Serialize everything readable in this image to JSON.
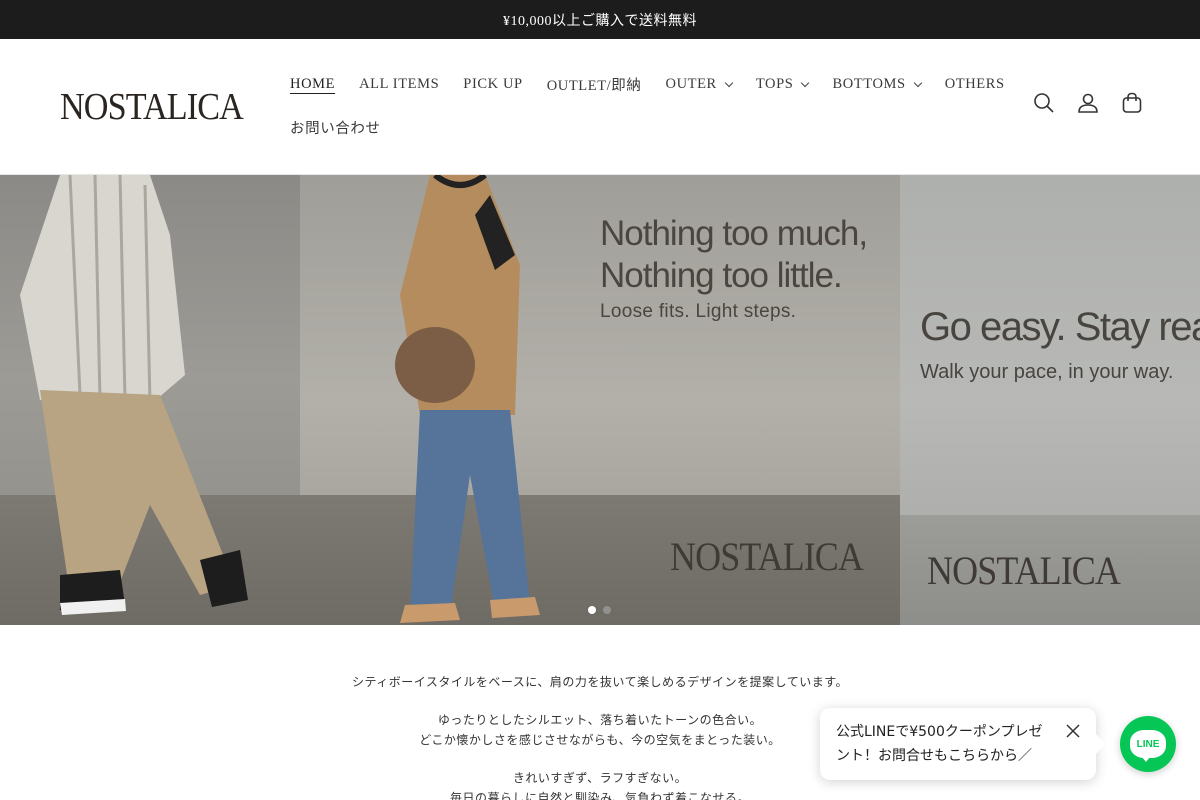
{
  "announcement": {
    "text": "¥10,000以上ご購入で送料無料"
  },
  "header": {
    "logo": "NOSTALICA",
    "nav_row1": [
      {
        "label": "HOME",
        "active": true,
        "dropdown": false
      },
      {
        "label": "ALL ITEMS",
        "active": false,
        "dropdown": false
      },
      {
        "label": "PICK UP",
        "active": false,
        "dropdown": false
      },
      {
        "label": "OUTLET/即納",
        "active": false,
        "dropdown": false
      },
      {
        "label": "OUTER",
        "active": false,
        "dropdown": true
      },
      {
        "label": "TOPS",
        "active": false,
        "dropdown": true
      },
      {
        "label": "BOTTOMS",
        "active": false,
        "dropdown": true
      },
      {
        "label": "OTHERS",
        "active": false,
        "dropdown": false
      }
    ],
    "nav_row2": [
      {
        "label": "お問い合わせ",
        "active": false,
        "dropdown": false
      }
    ],
    "icons": [
      "search-icon",
      "account-icon",
      "cart-icon"
    ]
  },
  "hero": {
    "slide_mid": {
      "headline_line1": "Nothing too much,",
      "headline_line2": "Nothing too little.",
      "subline": "Loose fits. Light steps.",
      "brand": "NOSTALICA"
    },
    "slide_right": {
      "headline": "Go easy. Stay real.",
      "subline": "Walk your pace, in your way.",
      "brand": "NOSTALICA"
    },
    "dots": {
      "count": 2,
      "active_index": 0
    }
  },
  "intro": {
    "line1": "シティボーイスタイルをベースに、肩の力を抜いて楽しめるデザインを提案しています。",
    "line2": "ゆったりとしたシルエット、落ち着いたトーンの色合い。",
    "line3": "どこか懐かしさを感じさせながらも、今の空気をまとった装い。",
    "line4": "きれいすぎず、ラフすぎない。",
    "line5": "毎日の暮らしに自然と馴染み、気負わず着こなせる。"
  },
  "line_popup": {
    "text": "公式LINEで¥500クーポンプレゼント！お問合せもこちらから／",
    "button_label": "LINE"
  },
  "colors": {
    "announcement_bg": "#1c1c1c",
    "line_green": "#06c755",
    "text": "#222222"
  }
}
